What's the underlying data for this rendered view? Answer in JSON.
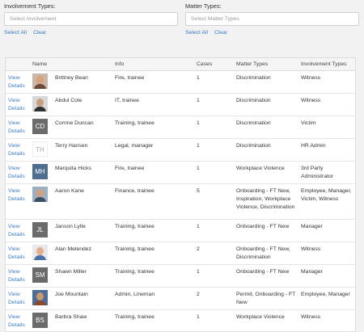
{
  "filters": {
    "involvement": {
      "label": "Involvement Types:",
      "placeholder": "Select Involvement",
      "select_all": "Select All",
      "clear": "Clear"
    },
    "matter": {
      "label": "Matter Types:",
      "placeholder": "Select Matter Types",
      "select_all": "Select All",
      "clear": "Clear"
    }
  },
  "table": {
    "headers": {
      "name": "Name",
      "info": "Info",
      "cases": "Cases",
      "matter_types": "Matter Types",
      "involvement_types": "Involvement Types"
    },
    "view_label_1": "View",
    "view_label_2": "Details",
    "rows": [
      {
        "name": "Brittney Bean",
        "info": "Fire, trainee",
        "cases": "1",
        "matter": "Discrimination",
        "involvement": "Witness"
      },
      {
        "name": "Abdul Cole",
        "info": "IT, trainee",
        "cases": "1",
        "matter": "Discrimination",
        "involvement": "Witness"
      },
      {
        "name": "Corrine Duncan",
        "initials": "CD",
        "info": "Training, trainee",
        "cases": "1",
        "matter": "Discrimination",
        "involvement": "Victim"
      },
      {
        "name": "Terry Hansen",
        "initials": "TH",
        "info": "Legal, manager",
        "cases": "1",
        "matter": "Discrimination",
        "involvement": "HR Admin"
      },
      {
        "name": "Marquita Hicks",
        "initials": "MH",
        "info": "Fire, trainee",
        "cases": "1",
        "matter": "Workplace Violence",
        "involvement": "3rd Party Administrator"
      },
      {
        "name": "Aaron Kane",
        "info": "Finance, trainee",
        "cases": "5",
        "matter": "Onboarding - FT New, Inspiration, Workplace Violence, Discrimination",
        "involvement": "Employee, Manager, Victim, Witness"
      },
      {
        "name": "Janson Lytle",
        "initials": "JL",
        "info": "Training, trainee",
        "cases": "1",
        "matter": "Onboarding - FT New",
        "involvement": "Manager"
      },
      {
        "name": "Alan Melendez",
        "info": "Training, trainee",
        "cases": "2",
        "matter": "Onboarding - FT New, Discrimination",
        "involvement": "Witness"
      },
      {
        "name": "Shawn Miller",
        "initials": "SM",
        "info": "Training, trainee",
        "cases": "1",
        "matter": "Onboarding - FT New",
        "involvement": "Manager"
      },
      {
        "name": "Joe Mountain",
        "info": "Admin, Lineman",
        "cases": "2",
        "matter": "Permit, Onboarding - FT New",
        "involvement": "Employee, Manager"
      },
      {
        "name": "Barbra Shaw",
        "initials": "BS",
        "info": "Training, trainee",
        "cases": "1",
        "matter": "Workplace Violence",
        "involvement": "Witness"
      }
    ]
  }
}
